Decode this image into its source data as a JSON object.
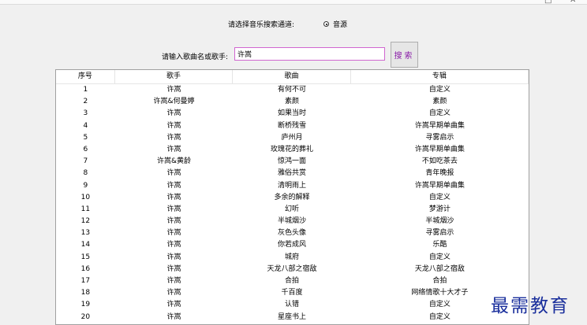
{
  "window": {
    "maximize_glyph": "□",
    "close_glyph": "✕"
  },
  "channel": {
    "label": "请选择音乐搜索通道:",
    "option_label": "音源"
  },
  "search": {
    "label": "请输入歌曲名或歌手:",
    "value": "许嵩",
    "button_label": "搜索"
  },
  "table": {
    "columns": [
      "序号",
      "歌手",
      "歌曲",
      "专辑"
    ],
    "rows": [
      [
        "1",
        "许嵩",
        "有何不可",
        "自定义"
      ],
      [
        "2",
        "许嵩&何曼婷",
        "素颜",
        "素颜"
      ],
      [
        "3",
        "许嵩",
        "如果当时",
        "自定义"
      ],
      [
        "4",
        "许嵩",
        "断桥残雪",
        "许嵩早期单曲集"
      ],
      [
        "5",
        "许嵩",
        "庐州月",
        "寻雾启示"
      ],
      [
        "6",
        "许嵩",
        "玫瑰花的葬礼",
        "许嵩早期单曲集"
      ],
      [
        "7",
        "许嵩&黄龄",
        "惊鸿一面",
        "不如吃茶去"
      ],
      [
        "8",
        "许嵩",
        "雅俗共赏",
        "青年晚报"
      ],
      [
        "9",
        "许嵩",
        "清明雨上",
        "许嵩早期单曲集"
      ],
      [
        "10",
        "许嵩",
        "多余的解释",
        "自定义"
      ],
      [
        "11",
        "许嵩",
        "幻听",
        "梦游计"
      ],
      [
        "12",
        "许嵩",
        "半城烟沙",
        "半城烟沙"
      ],
      [
        "13",
        "许嵩",
        "灰色头像",
        "寻雾启示"
      ],
      [
        "14",
        "许嵩",
        "你若成风",
        "乐酷"
      ],
      [
        "15",
        "许嵩",
        "城府",
        "自定义"
      ],
      [
        "16",
        "许嵩",
        "天龙八部之宿敌",
        "天龙八部之宿敌"
      ],
      [
        "17",
        "许嵩",
        "合拍",
        "合拍"
      ],
      [
        "18",
        "许嵩",
        "千百度",
        "网络情歌十大才子"
      ],
      [
        "19",
        "许嵩",
        "认错",
        "自定义"
      ],
      [
        "20",
        "许嵩",
        "星座书上",
        "自定义"
      ]
    ]
  },
  "watermark": {
    "text": "最需教育",
    "color": "#1a2f9c"
  },
  "colors": {
    "input_border": "#d066d0",
    "button_text": "#8a1ea8"
  }
}
